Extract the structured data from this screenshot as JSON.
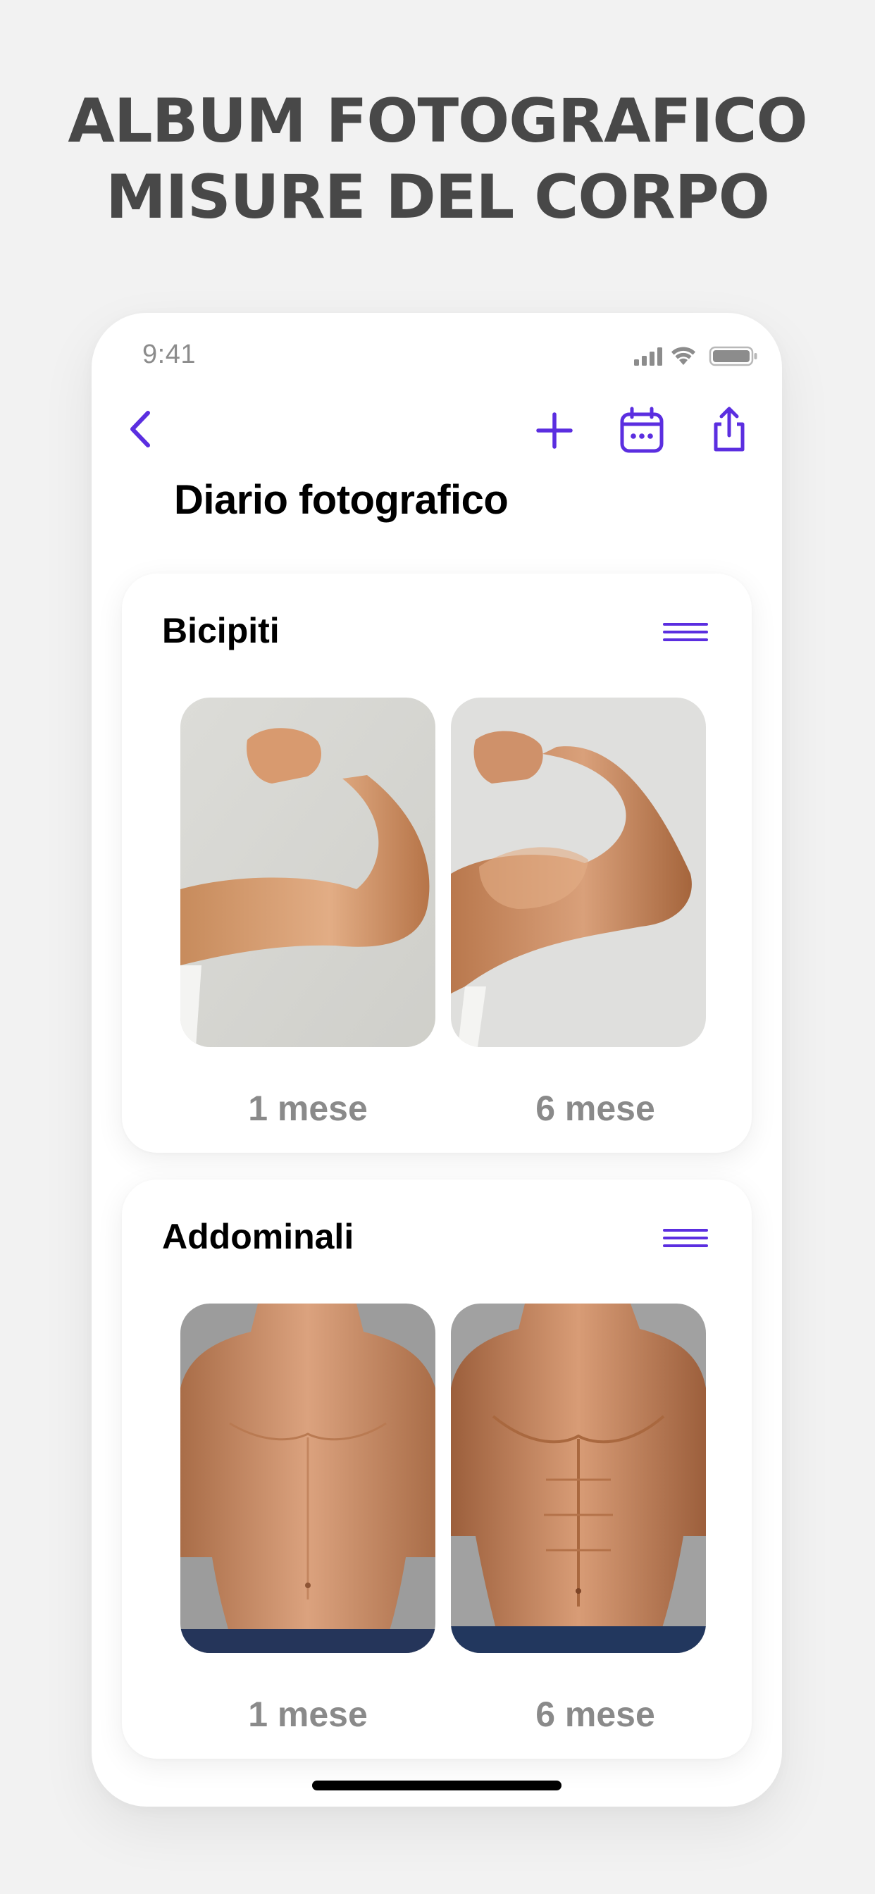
{
  "headline": {
    "line1": "ALBUM FOTOGRAFICO",
    "line2": "MISURE DEL CORPO"
  },
  "status_bar": {
    "time": "9:41",
    "icons": [
      "cellular-signal-icon",
      "wifi-icon",
      "battery-icon"
    ]
  },
  "nav": {
    "back_icon": "chevron-left-icon",
    "actions": [
      "plus-icon",
      "calendar-icon",
      "share-icon"
    ],
    "accent_color": "#5b2ee0"
  },
  "page": {
    "title": "Diario fotografico"
  },
  "sections": [
    {
      "title": "Bicipiti",
      "menu_icon": "menu-lines-icon",
      "photos": [
        {
          "label": "1 mese",
          "subject": "arm flexing biceps"
        },
        {
          "label": "6 mese",
          "subject": "muscular arm flexing biceps"
        }
      ]
    },
    {
      "title": "Addominali",
      "menu_icon": "menu-lines-icon",
      "photos": [
        {
          "label": "1 mese",
          "subject": "male torso"
        },
        {
          "label": "6 mese",
          "subject": "muscular male torso with abs"
        }
      ]
    }
  ]
}
